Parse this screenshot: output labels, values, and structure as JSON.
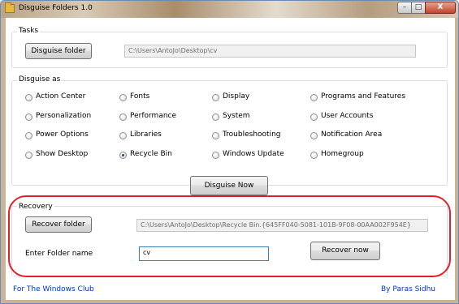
{
  "window": {
    "title": "Disguise Folders 1.0",
    "controls": {
      "minimize": "–",
      "maximize": "□",
      "close": "X"
    }
  },
  "tasks": {
    "group_title": "Tasks",
    "disguise_button": "Disguise folder",
    "path_value": "C:\\Users\\AntoJo\\Desktop\\cv"
  },
  "disguise_as": {
    "group_title": "Disguise as",
    "options": [
      {
        "label": "Action Center",
        "checked": false
      },
      {
        "label": "Fonts",
        "checked": false
      },
      {
        "label": "Display",
        "checked": false
      },
      {
        "label": "Programs and Features",
        "checked": false
      },
      {
        "label": "Personalization",
        "checked": false
      },
      {
        "label": "Performance",
        "checked": false
      },
      {
        "label": "System",
        "checked": false
      },
      {
        "label": "User Accounts",
        "checked": false
      },
      {
        "label": "Power Options",
        "checked": false
      },
      {
        "label": "Libraries",
        "checked": false
      },
      {
        "label": "Troubleshooting",
        "checked": false
      },
      {
        "label": "Notification Area",
        "checked": false
      },
      {
        "label": "Show Desktop",
        "checked": false
      },
      {
        "label": "Recycle Bin",
        "checked": true
      },
      {
        "label": "Windows Update",
        "checked": false
      },
      {
        "label": "Homegroup",
        "checked": false
      }
    ]
  },
  "disguise_now_button": "Disguise Now",
  "recovery": {
    "group_title": "Recovery",
    "recover_folder_button": "Recover folder",
    "path_value": "C:\\Users\\AntoJo\\Desktop\\Recycle Bin.{645FF040-5081-101B-9F08-00AA002F954E}",
    "folder_name_label": "Enter Folder name",
    "folder_name_value": "cv",
    "recover_now_button": "Recover now"
  },
  "footer": {
    "left_link": "For The Windows Club",
    "right_link": "By Paras Sidhu"
  },
  "colors": {
    "highlight": "#e2202a",
    "link": "#0033cc"
  }
}
